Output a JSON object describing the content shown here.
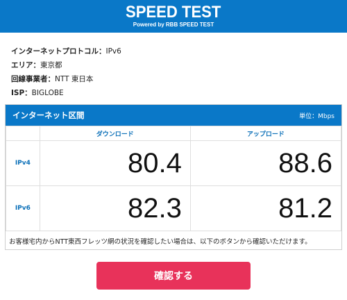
{
  "header": {
    "title": "SPEED TEST",
    "subtitle": "Powered by RBB SPEED TEST"
  },
  "info": [
    {
      "key": "インターネットプロトコル：",
      "value": "IPv6"
    },
    {
      "key": "エリア：",
      "value": "東京都"
    },
    {
      "key": "回線事業者：",
      "value": "NTT 東日本"
    },
    {
      "key": "ISP：",
      "value": "BIGLOBE"
    }
  ],
  "panel": {
    "title": "インターネット区間",
    "unit": "単位：Mbps",
    "columns": [
      "ダウンロード",
      "アップロード"
    ],
    "rows": [
      {
        "label": "IPv4",
        "download": "80.4",
        "upload": "88.6"
      },
      {
        "label": "IPv6",
        "download": "82.3",
        "upload": "81.2"
      }
    ],
    "note": "お客様宅内からNTT東西フレッツ網の状況を確認したい場合は、以下のボタンから確認いただけます。"
  },
  "button": {
    "label": "確認する"
  },
  "colors": {
    "brand_blue": "#0a78c8",
    "button_red": "#e8325a"
  }
}
